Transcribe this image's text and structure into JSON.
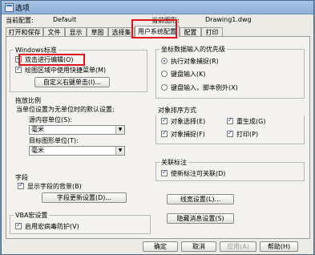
{
  "window": {
    "title": "选项"
  },
  "header": {
    "profile_label": "当前配置:",
    "profile_value": "Default",
    "drawing_label": "当前图形:",
    "drawing_value": "Drawing1.dwg"
  },
  "tabs": [
    {
      "label": "打开和保存"
    },
    {
      "label": "文件"
    },
    {
      "label": "显示"
    },
    {
      "label": "草图"
    },
    {
      "label": "选择集"
    },
    {
      "label": "用户系统配置"
    },
    {
      "label": "配置"
    },
    {
      "label": "打印"
    }
  ],
  "windows_std": {
    "title": "Windows标准",
    "dblclick_label": "双击进行编辑(O)",
    "shortcut_label": "绘图区域中使用快捷菜单(M)",
    "right_click_btn": "自定义右键单击(I)..."
  },
  "priority": {
    "title": "坐标数据输入的优先级",
    "opt1": "执行对象捕捉(R)",
    "opt2": "键盘输入(K)",
    "opt3": "键盘输入，脚本例外(X)"
  },
  "drag": {
    "title": "拖放比例",
    "desc": "当单位设置为无单位时的默认设置:",
    "source_label": "源内容单位(S):",
    "source_value": "毫米",
    "target_label": "目标图形单位(T):",
    "target_value": "毫米"
  },
  "sort": {
    "title": "对象排序方式",
    "select": "对象选择(E)",
    "regen": "重生成(G)",
    "snap": "对象捕捉(F)",
    "print": "打印(P)"
  },
  "field": {
    "title": "字段",
    "show_bg": "显示字段的背景(B)",
    "update_btn": "字段更新设置(D)..."
  },
  "assoc": {
    "title": "关联标注",
    "new_assoc": "使新标注可关联(D)"
  },
  "lineweight_btn": "线宽设置(L)...",
  "vba": {
    "title": "VBA宏设置",
    "protect": "启用宏病毒防护(V)"
  },
  "hidden_msg_btn": "隐藏消息设置(S)",
  "footer": {
    "ok": "确定",
    "cancel": "取消",
    "apply": "应用(A)",
    "help": "帮助(H)"
  },
  "colors": {
    "highlight": "#e0131d"
  }
}
